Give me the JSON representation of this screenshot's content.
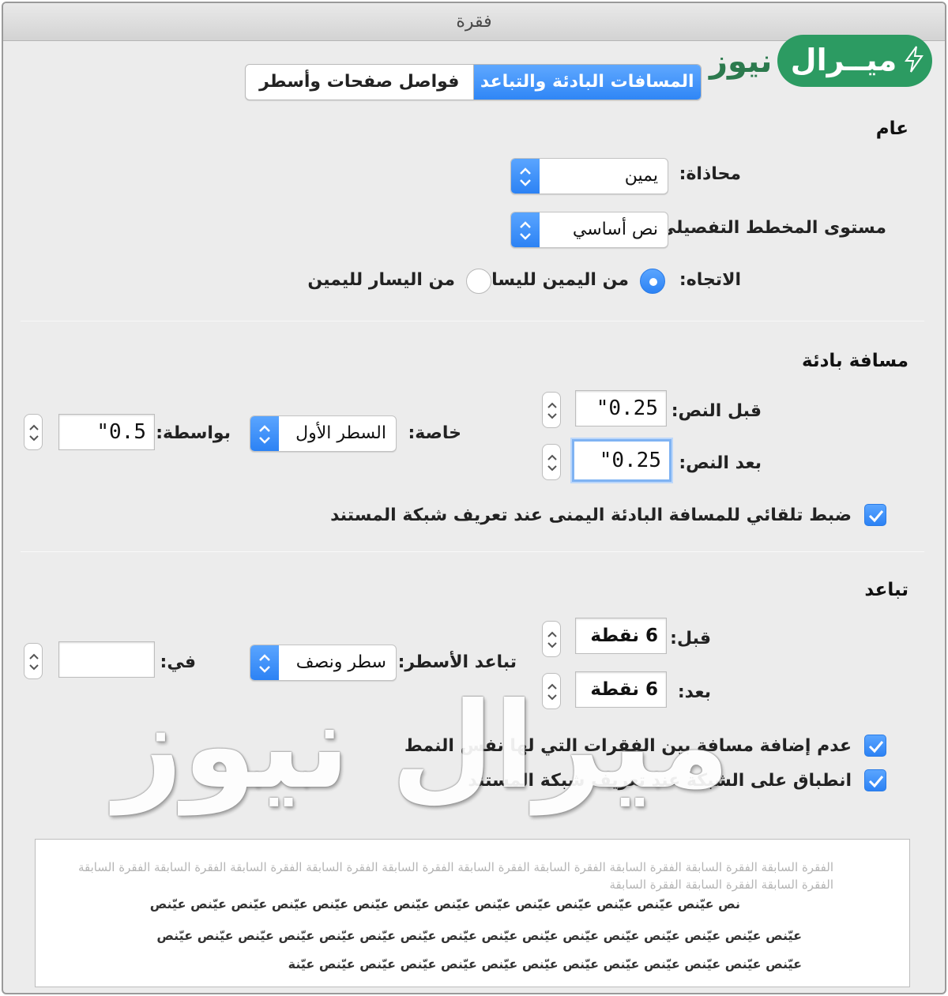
{
  "window": {
    "title": "فقرة"
  },
  "tabs": [
    {
      "label": "فواصل صفحات وأسطر",
      "active": false
    },
    {
      "label": "المسافات البادئة والتباعد",
      "active": true
    }
  ],
  "logo": {
    "pill_text": "ميــرال",
    "word": "نيوز",
    "color": "#2c9b62"
  },
  "general": {
    "title": "عام",
    "alignment": {
      "label": "محاذاة:",
      "value": "يمين"
    },
    "outline_level": {
      "label": "مستوى المخطط التفصيلي:",
      "value": "نص أساسي"
    },
    "direction": {
      "label": "الاتجاه:",
      "options": [
        {
          "label": "من اليمين لليسار",
          "selected": true
        },
        {
          "label": "من اليسار لليمين",
          "selected": false
        }
      ]
    }
  },
  "indentation": {
    "title": "مسافة بادئة",
    "before_text": {
      "label": "قبل النص:",
      "value": "\"0.25"
    },
    "after_text": {
      "label": "بعد النص:",
      "value": "\"0.25"
    },
    "special": {
      "label": "خاصة:",
      "value": "السطر الأول"
    },
    "by": {
      "label": "بواسطة:",
      "value": "\"0.5"
    },
    "auto_adjust": {
      "label": "ضبط تلقائي للمسافة البادئة اليمنى عند تعريف شبكة المستند",
      "checked": true
    }
  },
  "spacing": {
    "title": "تباعد",
    "before": {
      "label": "قبل:",
      "value": "6 نقطة"
    },
    "after": {
      "label": "بعد:",
      "value": "6 نقطة"
    },
    "line_spacing": {
      "label": "تباعد الأسطر:",
      "value": "سطر ونصف"
    },
    "at": {
      "label": "في:",
      "value": ""
    },
    "dont_add_space": {
      "label": "عدم إضافة مسافة بين الفقرات التي لها نفس النمط",
      "checked": true
    },
    "snap_to_grid": {
      "label": "انطباق على الشبكة عند تعريف شبكة المستند",
      "checked": true
    }
  },
  "preview": {
    "previous_line_1": "الفقرة السابقة الفقرة السابقة الفقرة السابقة الفقرة السابقة الفقرة السابقة الفقرة السابقة الفقرة السابقة الفقرة السابقة الفقرة السابقة الفقرة السابقة",
    "previous_line_2": "الفقرة السابقة الفقرة السابقة الفقرة السابقة",
    "sample_line_1": "نص عيّنص عيّنص عيّنص عيّنص عيّنص عيّنص عيّنص عيّنص عيّنص عيّنص عيّنص عيّنص عيّنص عيّنص",
    "sample_line_2": "عيّنص عيّنص عيّنص عيّنص عيّنص عيّنص عيّنص عيّنص عيّنص عيّنص عيّنص عيّنص عيّنص عيّنص عيّنص عيّنص",
    "sample_line_3": "عيّنص عيّنص عيّنص عيّنص عيّنص عيّنص عيّنص عيّنص عيّنص عيّنص عيّنص عيّنص عيّنة"
  },
  "watermark": {
    "text": "ميرال نيوز"
  },
  "colors": {
    "accent": "#2f86f6",
    "window_bg": "#ececec"
  }
}
